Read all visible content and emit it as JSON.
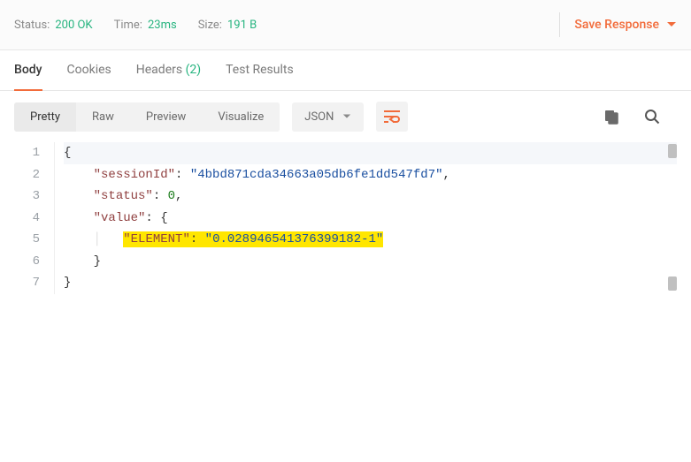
{
  "status_bar": {
    "status_label": "Status:",
    "status_value": "200 OK",
    "time_label": "Time:",
    "time_value": "23ms",
    "size_label": "Size:",
    "size_value": "191 B",
    "save_response": "Save Response"
  },
  "tabs": {
    "body": "Body",
    "cookies": "Cookies",
    "headers": "Headers",
    "headers_count": "(2)",
    "test_results": "Test Results"
  },
  "toolbar": {
    "pretty": "Pretty",
    "raw": "Raw",
    "preview": "Preview",
    "visualize": "Visualize",
    "format_label": "JSON"
  },
  "code": {
    "line_numbers": [
      "1",
      "2",
      "3",
      "4",
      "5",
      "6",
      "7"
    ],
    "l1_brace": "{",
    "l2_key": "\"sessionId\"",
    "l2_val": "\"4bbd871cda34663a05db6fe1dd547fd7\"",
    "l3_key": "\"status\"",
    "l3_val": "0",
    "l4_key": "\"value\"",
    "l4_brace": "{",
    "l5_key": "\"ELEMENT\"",
    "l5_val": "\"0.028946541376399182-1\"",
    "l6_brace": "}",
    "l7_brace": "}",
    "colon": ":",
    "comma": ","
  }
}
